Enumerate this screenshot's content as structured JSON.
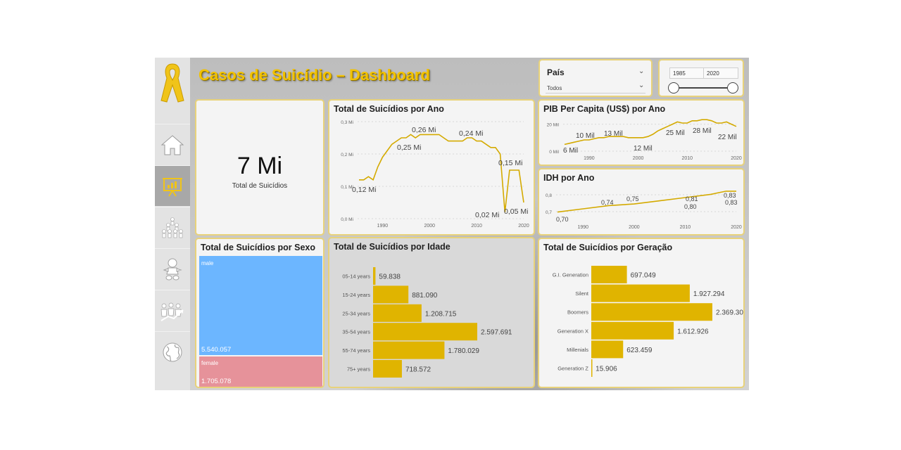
{
  "header": {
    "title": "Casos de Suicídio – Dashboard"
  },
  "colors": {
    "accent": "#e0b400",
    "male": "#6cb6ff",
    "female": "#e6929a",
    "line": "#d4aa00"
  },
  "sidebar": {
    "items": [
      {
        "icon": "ribbon-icon"
      },
      {
        "icon": "home-icon"
      },
      {
        "icon": "presentation-chart-icon",
        "active": true
      },
      {
        "icon": "population-icon"
      },
      {
        "icon": "baby-icon"
      },
      {
        "icon": "people-growth-icon"
      },
      {
        "icon": "globe-icon"
      }
    ]
  },
  "slicers": {
    "country": {
      "label": "País",
      "value": "Todos"
    },
    "year": {
      "from": "1985",
      "to": "2020"
    }
  },
  "kpi": {
    "value": "7 Mi",
    "label": "Total de Suicídios"
  },
  "charts": {
    "by_year": {
      "title": "Total de Suicídios por Ano",
      "y_ticks": [
        "0,3 Mi",
        "0,2 Mi",
        "0,1 Mi",
        "0,0 Mi"
      ],
      "x_ticks": [
        "1990",
        "2000",
        "2010",
        "2020"
      ],
      "labels": [
        "0,12 Mi",
        "0,25 Mi",
        "0,26 Mi",
        "0,24 Mi",
        "0,15 Mi",
        "0,02 Mi",
        "0,05 Mi"
      ]
    },
    "gdp": {
      "title": "PIB Per Capita (US$) por Ano",
      "y_ticks": [
        "20 Mil",
        "0 Mil"
      ],
      "x_ticks": [
        "1990",
        "2000",
        "2010",
        "2020"
      ],
      "labels": [
        "6 Mil",
        "10 Mil",
        "13 Mil",
        "12 Mil",
        "25 Mil",
        "28 Mil",
        "22 Mil"
      ]
    },
    "hdi": {
      "title": "IDH por Ano",
      "y_ticks": [
        "0,8",
        "0,7"
      ],
      "x_ticks": [
        "1990",
        "2000",
        "2010",
        "2020"
      ],
      "labels": [
        "0,70",
        "0,74",
        "0,75",
        "0,81",
        "0,80",
        "0,83",
        "0,83"
      ]
    },
    "by_sex": {
      "title": "Total de Suicídios por Sexo",
      "male_label": "male",
      "male_value": "5.540.057",
      "female_label": "female",
      "female_value": "1.705.078"
    },
    "by_age": {
      "title": "Total de Suicídios por Idade",
      "value_labels": [
        "59.838",
        "881.090",
        "1.208.715",
        "2.597.691",
        "1.780.029",
        "718.572"
      ]
    },
    "by_generation": {
      "title": "Total de Suicídios por Geração",
      "value_labels": [
        "697.049",
        "1.927.294",
        "2.369.301",
        "1.612.926",
        "623.459",
        "15.906"
      ]
    }
  },
  "chart_data": [
    {
      "type": "line",
      "title": "Total de Suicídios por Ano",
      "x": [
        1985,
        1986,
        1987,
        1988,
        1989,
        1990,
        1991,
        1992,
        1993,
        1994,
        1995,
        1996,
        1997,
        1998,
        1999,
        2000,
        2001,
        2002,
        2003,
        2004,
        2005,
        2006,
        2007,
        2008,
        2009,
        2010,
        2011,
        2012,
        2013,
        2014,
        2015,
        2016,
        2017,
        2018,
        2019,
        2020
      ],
      "values": [
        0.12,
        0.12,
        0.13,
        0.12,
        0.16,
        0.19,
        0.21,
        0.23,
        0.24,
        0.25,
        0.25,
        0.26,
        0.25,
        0.26,
        0.26,
        0.26,
        0.26,
        0.26,
        0.25,
        0.24,
        0.24,
        0.24,
        0.24,
        0.25,
        0.25,
        0.24,
        0.24,
        0.23,
        0.22,
        0.22,
        0.2,
        0.02,
        0.15,
        0.15,
        0.15,
        0.05
      ],
      "ylim": [
        0,
        0.3
      ]
    },
    {
      "type": "line",
      "title": "PIB Per Capita (US$) por Ano",
      "x": [
        1985,
        1986,
        1987,
        1988,
        1989,
        1990,
        1991,
        1992,
        1993,
        1994,
        1995,
        1996,
        1997,
        1998,
        1999,
        2000,
        2001,
        2002,
        2003,
        2004,
        2005,
        2006,
        2007,
        2008,
        2009,
        2010,
        2011,
        2012,
        2013,
        2014,
        2015,
        2016,
        2017,
        2018,
        2019,
        2020
      ],
      "values": [
        6,
        7,
        8,
        9,
        10,
        10,
        11,
        12,
        12,
        13,
        13,
        13,
        13,
        12,
        12,
        12,
        12,
        13,
        15,
        18,
        20,
        22,
        24,
        26,
        25,
        25,
        27,
        27,
        28,
        28,
        27,
        25,
        25,
        26,
        24,
        22
      ],
      "ylim": [
        0,
        30
      ]
    },
    {
      "type": "line",
      "title": "IDH por Ano",
      "x": [
        1985,
        1990,
        1995,
        2000,
        2005,
        2010,
        2015,
        2018,
        2020
      ],
      "values": [
        0.7,
        0.72,
        0.74,
        0.75,
        0.77,
        0.79,
        0.81,
        0.83,
        0.83
      ],
      "ylim": [
        0.65,
        0.86
      ]
    },
    {
      "type": "bar",
      "title": "Total de Suicídios por Idade",
      "categories": [
        "05-14 years",
        "15-24 years",
        "25-34 years",
        "35-54 years",
        "55-74 years",
        "75+ years"
      ],
      "values": [
        59838,
        881090,
        1208715,
        2597691,
        1780029,
        718572
      ]
    },
    {
      "type": "bar",
      "title": "Total de Suicídios por Geração",
      "categories": [
        "G.I. Generation",
        "Silent",
        "Boomers",
        "Generation X",
        "Millenials",
        "Generation Z"
      ],
      "values": [
        697049,
        1927294,
        2369301,
        1612926,
        623459,
        15906
      ]
    }
  ]
}
